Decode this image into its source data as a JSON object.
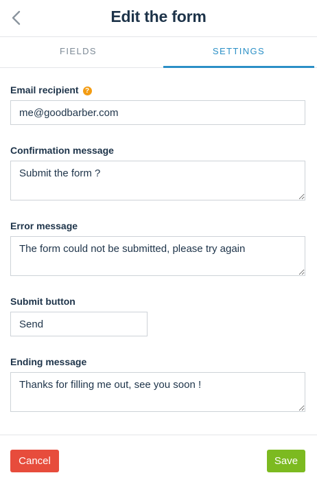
{
  "header": {
    "title": "Edit the form"
  },
  "tabs": [
    {
      "label": "FIELDS"
    },
    {
      "label": "SETTINGS"
    }
  ],
  "form": {
    "email_recipient": {
      "label": "Email recipient",
      "value": "me@goodbarber.com"
    },
    "confirmation_message": {
      "label": "Confirmation message",
      "value": "Submit the form ?"
    },
    "error_message": {
      "label": "Error message",
      "value": "The form could not be submitted, please try again"
    },
    "submit_button": {
      "label": "Submit button",
      "value": "Send"
    },
    "ending_message": {
      "label": "Ending message",
      "value": "Thanks for filling me out, see you soon !"
    }
  },
  "footer": {
    "cancel_label": "Cancel",
    "save_label": "Save"
  },
  "colors": {
    "accent": "#2a8fc6",
    "cancel": "#e74c3c",
    "save": "#7cba20",
    "help": "#f39c12"
  }
}
